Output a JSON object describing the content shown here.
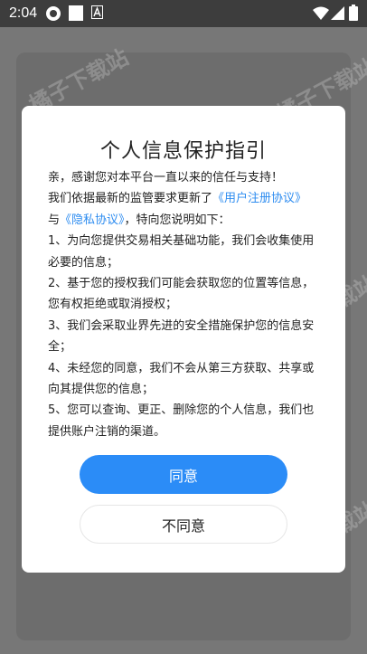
{
  "status_bar": {
    "time": "2:04",
    "icons": [
      "sim-app-icon",
      "white-square-icon",
      "text-a-icon",
      "wifi-icon",
      "signal-icon",
      "battery-icon"
    ]
  },
  "watermark": {
    "text": "橘子下载站"
  },
  "dialog": {
    "title": "个人信息保护指引",
    "intro_1": "亲，感谢您对本平台一直以来的信任与支持！",
    "intro_2_prefix": "我们依据最新的监管要求更新了",
    "link_user_agreement": "《用户注册协议》",
    "intro_3_prefix": "与",
    "link_privacy": "《隐私协议》",
    "intro_3_suffix": "，特向您说明如下：",
    "items": [
      "1、为向您提供交易相关基础功能，我们会收集使用必要的信息；",
      "2、基于您的授权我们可能会获取您的位置等信息，您有权拒绝或取消授权；",
      "3、我们会采取业界先进的安全措施保护您的信息安全；",
      "4、未经您的同意，我们不会从第三方获取、共享或向其提供您的信息；",
      "5、您可以查询、更正、删除您的个人信息，我们也提供账户注销的渠道。"
    ],
    "agree_label": "同意",
    "disagree_label": "不同意"
  },
  "colors": {
    "accent": "#2b8cf7",
    "link": "#2d8cf0",
    "overlay": "#777777"
  }
}
